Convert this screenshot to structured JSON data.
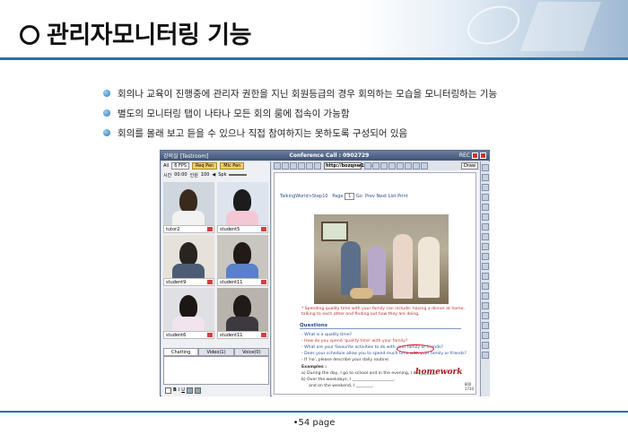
{
  "header": {
    "title": "관리자모니터링 기능"
  },
  "bullets": [
    "회의나 교육이 진행중에 관리자 권한을 지닌 회원등급의 경우 회의하는 모습을 모니터링하는 기능",
    "별도의 모니터링 탭이 나타나 모든 회의 룸에 접속이 가능함",
    "회의를 몰래 보고 듣을 수 있으나 직접 참여하지는 못하도록 구성되어 있음"
  ],
  "app": {
    "window_title": "강의실 [Testroom]",
    "conference_call": "Conference Call : 0902729",
    "rec_label": "REC",
    "left_toolbar": {
      "all": "All",
      "fps": "6 FPS",
      "req_pen": "Req Pen",
      "mic_pen": "Mic Pen",
      "time_label": "시간",
      "time_value": "00:00",
      "count_label": "인원",
      "count_value": "100",
      "volume_label": "Spk"
    },
    "participants": [
      {
        "name": "tutor2"
      },
      {
        "name": "student5"
      },
      {
        "name": "student9"
      },
      {
        "name": "student11"
      },
      {
        "name": "student6"
      },
      {
        "name": "student11"
      }
    ],
    "chat_tabs": [
      "Chatting",
      "Video(1)",
      "Voice(0)"
    ],
    "url": "http://bozqnw14.n",
    "draw_label": "Draw",
    "doc_nav": {
      "breadcrumb": "TalkingWorld>Step10",
      "page_label": "Page",
      "page_value": "1",
      "go": "Go",
      "prev": "Prev",
      "next": "Next",
      "list": "List",
      "print": "Print"
    },
    "caption": "* Spending quality time with your family can include: having a dinner at home, talking to each other and finding out how they are doing.",
    "questions_title": "Questions",
    "questions": [
      "- What is a quality time?",
      "- How do you spend 'quality time' with your family?",
      "- What are your favourite activities to do with your family or friends?",
      "- Does your schedule allow you to spend much time with your family or friends?",
      "  - If 'no', please describe your daily routine."
    ],
    "examples_title": "Examples :",
    "examples": [
      "a) During the day, I go to school and in the evening, I do ________.",
      "b) Over the weekdays, I ____________________,",
      "and on the weekend, I ________."
    ],
    "handwriting": "homework",
    "zoom": "800\n1730"
  },
  "footer": {
    "page": "•54 page"
  }
}
